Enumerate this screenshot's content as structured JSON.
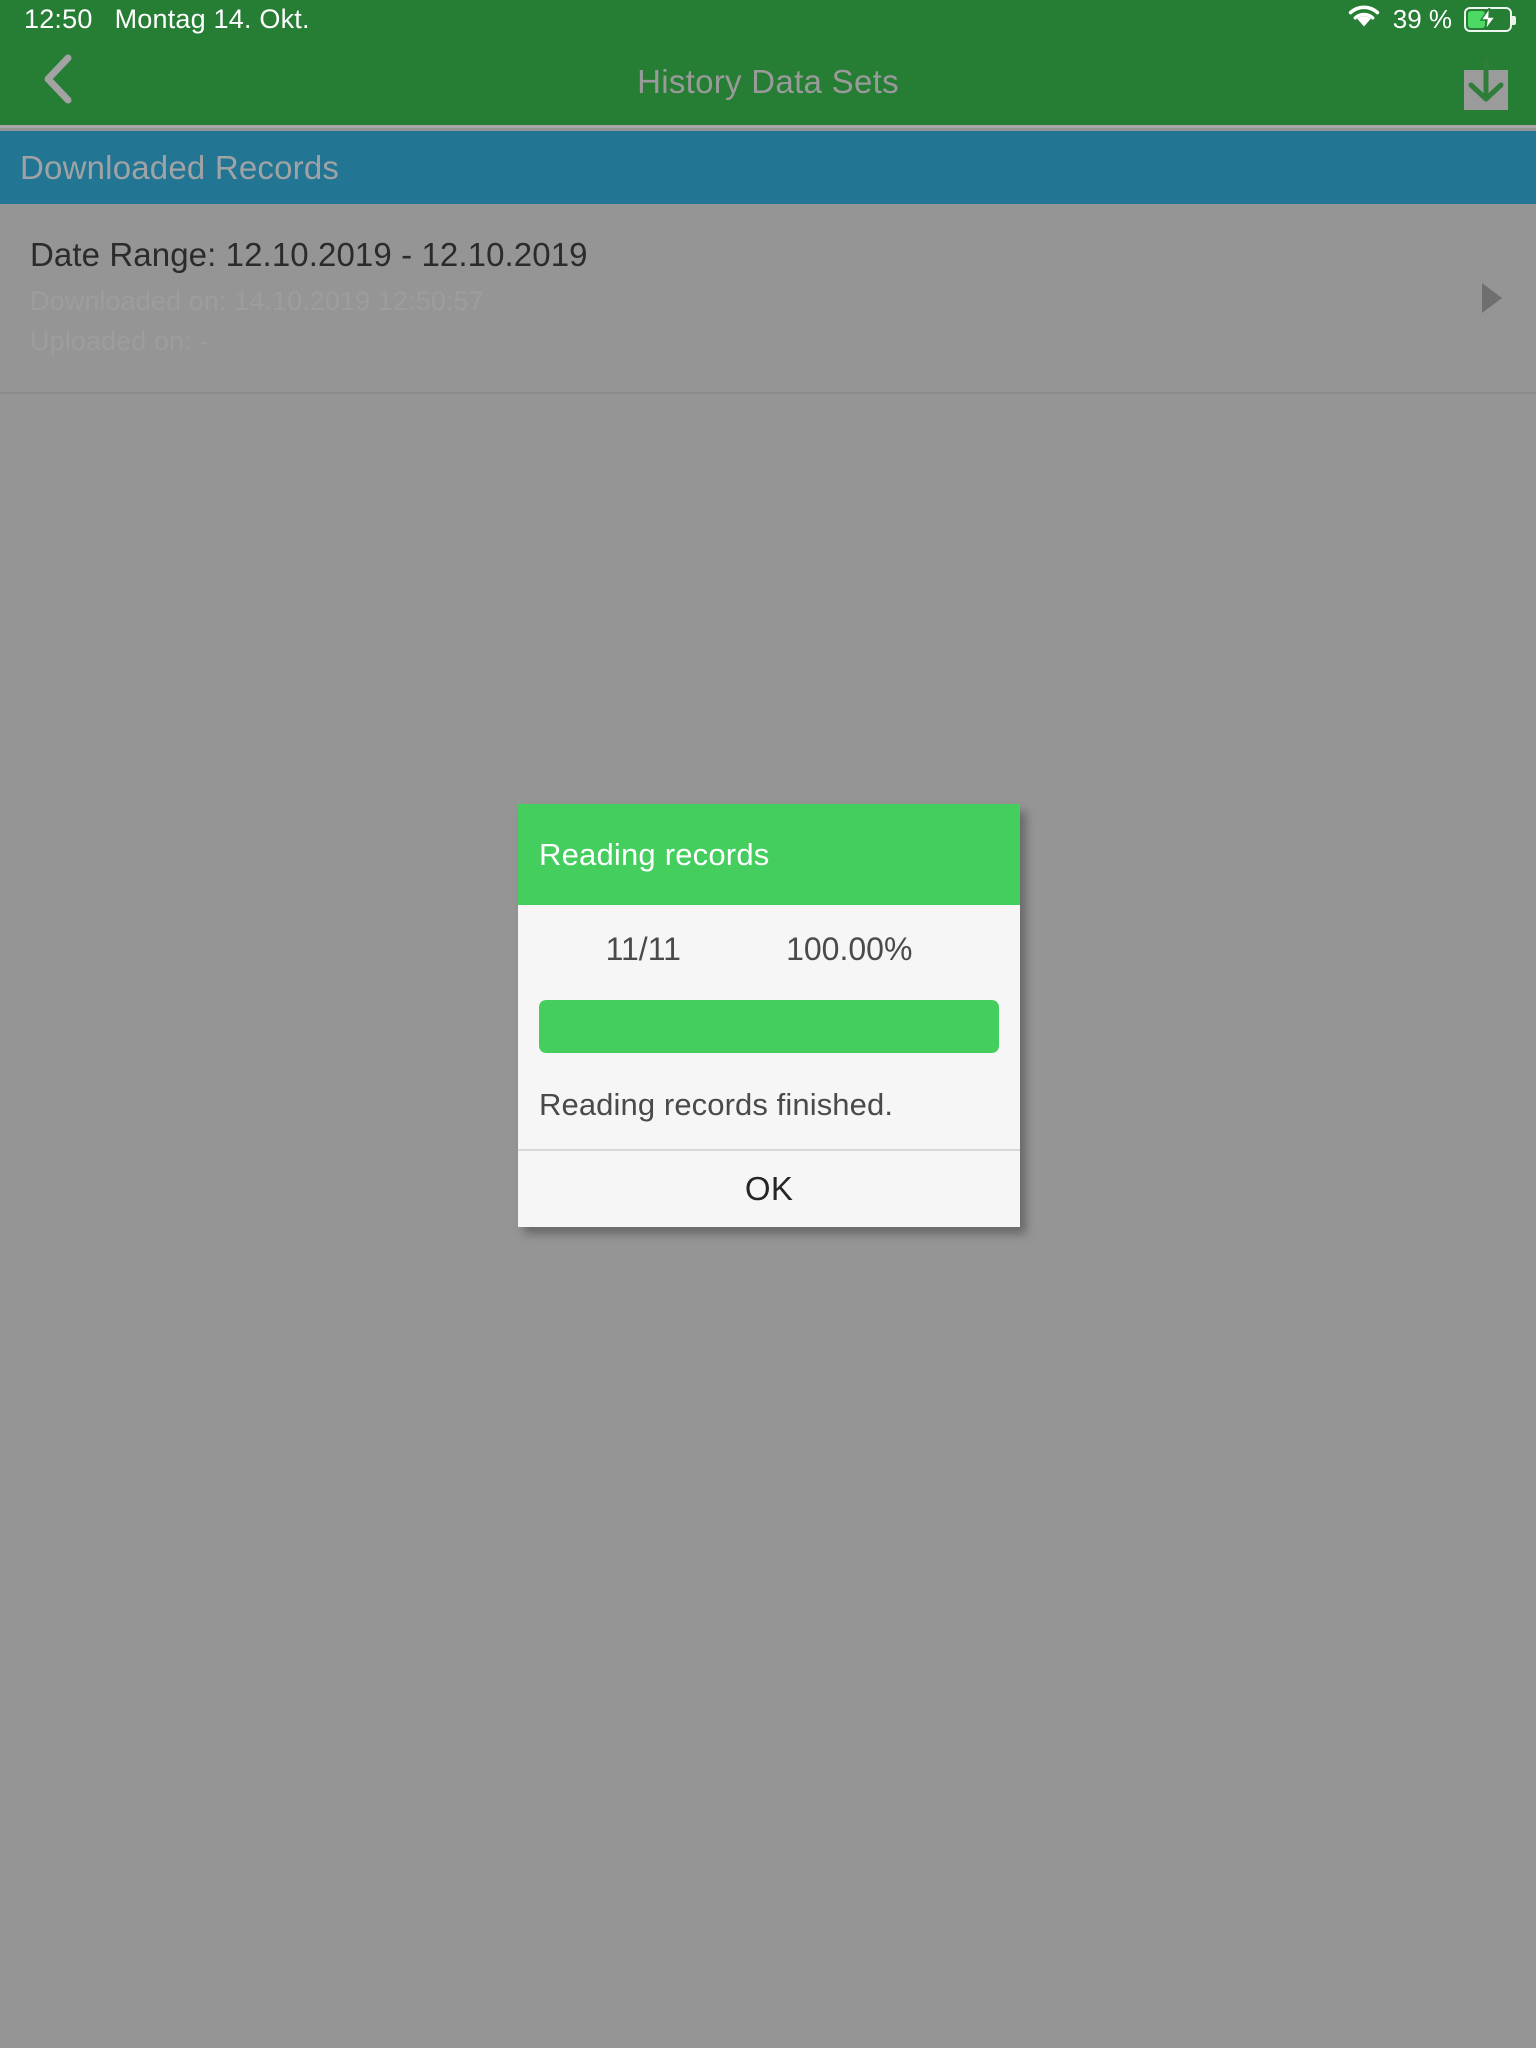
{
  "status_bar": {
    "time": "12:50",
    "date": "Montag 14. Okt.",
    "battery_percent": "39 %",
    "wifi_icon": "wifi-icon",
    "battery_icon": "battery-charging-icon"
  },
  "nav_bar": {
    "title": "History Data Sets",
    "back_icon": "chevron-left-icon",
    "download_icon": "download-icon"
  },
  "section": {
    "header_label": "Downloaded Records"
  },
  "records": [
    {
      "date_range": "Date Range: 12.10.2019 - 12.10.2019",
      "downloaded_on": "Downloaded on: 14.10.2019 12:50:57",
      "uploaded_on": "Uploaded on: -",
      "disclosure_icon": "play-triangle-icon"
    }
  ],
  "dialog": {
    "title": "Reading records",
    "progress_count": "11/11",
    "progress_percent": "100.00%",
    "progress_value": 100,
    "message": "Reading records finished.",
    "ok_label": "OK"
  },
  "colors": {
    "nav_green": "#267d34",
    "section_blue": "#237594",
    "dialog_green": "#43ce5e",
    "scrim_gray": "#959595",
    "battery_green": "#4cd964"
  }
}
